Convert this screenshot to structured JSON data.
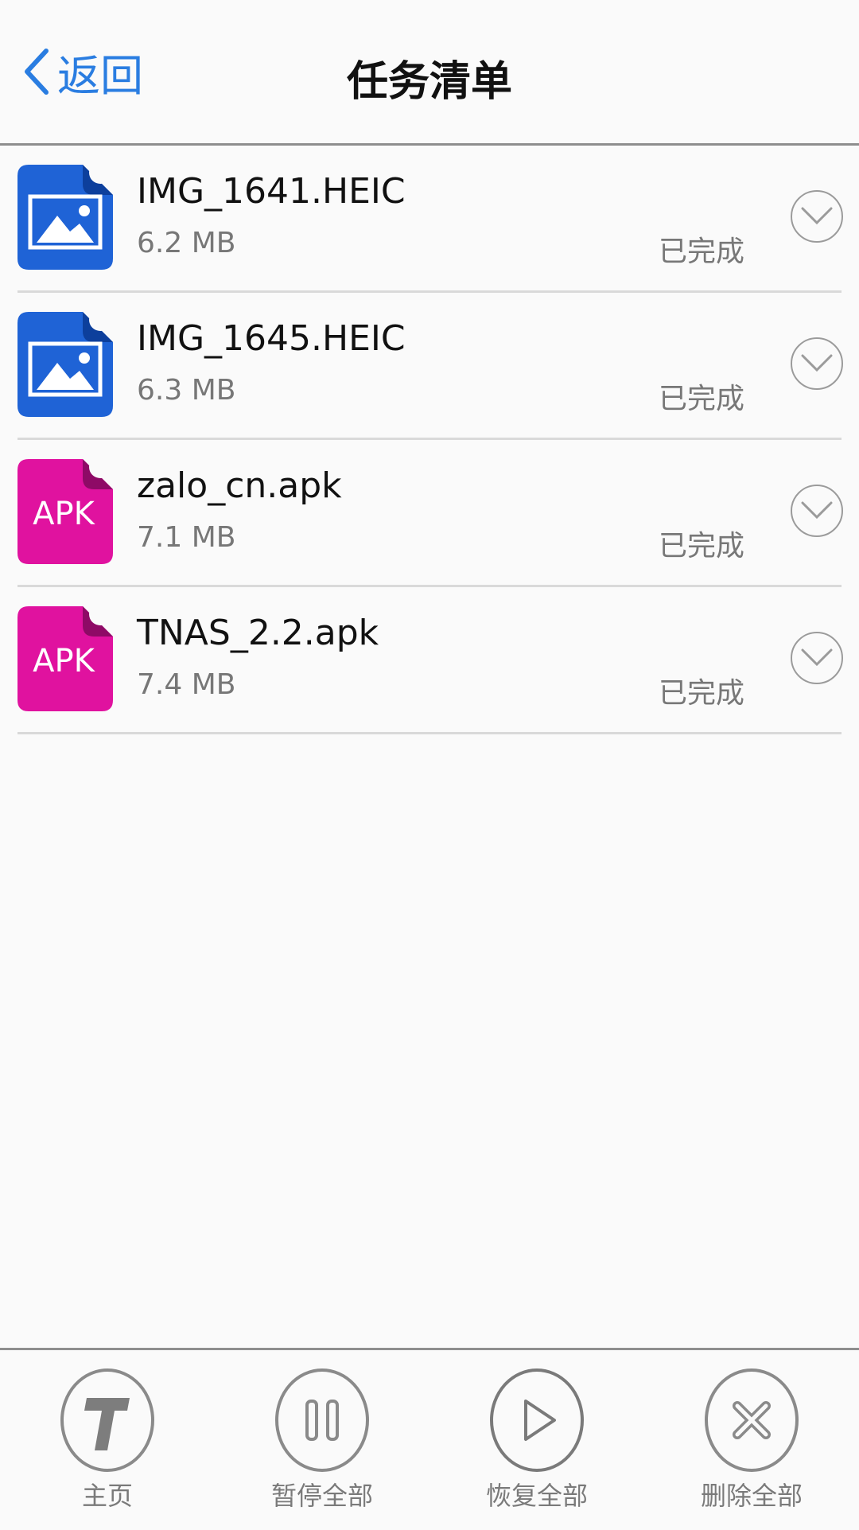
{
  "header": {
    "back_label": "返回",
    "title": "任务清单"
  },
  "tasks": [
    {
      "name": "IMG_1641.HEIC",
      "size": "6.2 MB",
      "status": "已完成",
      "type": "image"
    },
    {
      "name": "IMG_1645.HEIC",
      "size": "6.3 MB",
      "status": "已完成",
      "type": "image"
    },
    {
      "name": "zalo_cn.apk",
      "size": "7.1 MB",
      "status": "已完成",
      "type": "apk",
      "icon_text": "APK"
    },
    {
      "name": "TNAS_2.2.apk",
      "size": "7.4 MB",
      "status": "已完成",
      "type": "apk",
      "icon_text": "APK"
    }
  ],
  "toolbar": {
    "home_label": "主页",
    "pause_all_label": "暂停全部",
    "resume_all_label": "恢复全部",
    "delete_all_label": "删除全部"
  },
  "colors": {
    "accent": "#2a7de1",
    "image_icon": "#1f63d6",
    "apk_icon": "#e0129f",
    "divider": "#d9d9d9"
  }
}
